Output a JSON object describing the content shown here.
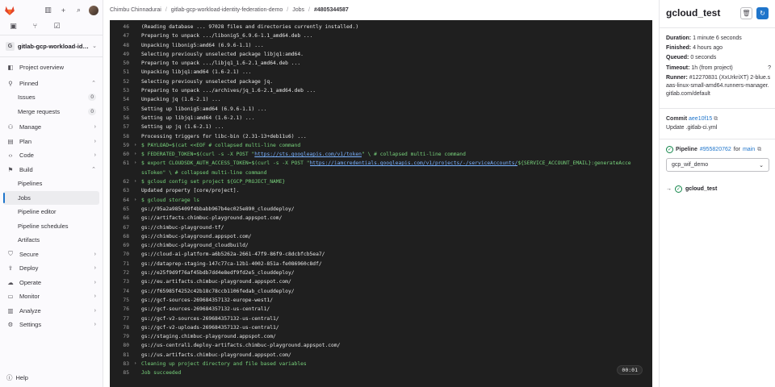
{
  "sidebar": {
    "project_initial": "G",
    "project_name": "gitlab-gcp-workload-ide...",
    "items": [
      {
        "label": "Project overview",
        "icon": "project-icon"
      },
      {
        "label": "Pinned",
        "icon": "pin-icon"
      },
      {
        "label": "Issues",
        "count": "0"
      },
      {
        "label": "Merge requests",
        "count": "0"
      },
      {
        "label": "Manage",
        "icon": "users-icon"
      },
      {
        "label": "Plan",
        "icon": "plan-icon"
      },
      {
        "label": "Code",
        "icon": "code-icon"
      },
      {
        "label": "Build",
        "icon": "rocket-icon"
      },
      {
        "label": "Pipelines"
      },
      {
        "label": "Jobs"
      },
      {
        "label": "Pipeline editor"
      },
      {
        "label": "Pipeline schedules"
      },
      {
        "label": "Artifacts"
      },
      {
        "label": "Secure",
        "icon": "shield-icon"
      },
      {
        "label": "Deploy",
        "icon": "deploy-icon"
      },
      {
        "label": "Operate",
        "icon": "cloud-icon"
      },
      {
        "label": "Monitor",
        "icon": "monitor-icon"
      },
      {
        "label": "Analyze",
        "icon": "chart-icon"
      },
      {
        "label": "Settings",
        "icon": "gear-icon"
      }
    ],
    "help": "Help"
  },
  "breadcrumb": [
    "Chimbu Chinnadurai",
    "gitlab-gcp-workload-identity-federation-demo",
    "Jobs",
    "#4805344587"
  ],
  "log": {
    "lines": [
      {
        "n": "46",
        "t": "(Reading database ... 97028 files and directories currently installed.)"
      },
      {
        "n": "47",
        "t": "Preparing to unpack .../libonig5_6.9.6-1.1_amd64.deb ..."
      },
      {
        "n": "48",
        "t": "Unpacking libonig5:amd64 (6.9.6-1.1) ..."
      },
      {
        "n": "49",
        "t": "Selecting previously unselected package libjq1:amd64."
      },
      {
        "n": "50",
        "t": "Preparing to unpack .../libjq1_1.6-2.1_amd64.deb ..."
      },
      {
        "n": "51",
        "t": "Unpacking libjq1:amd64 (1.6-2.1) ..."
      },
      {
        "n": "52",
        "t": "Selecting previously unselected package jq."
      },
      {
        "n": "53",
        "t": "Preparing to unpack .../archives/jq_1.6-2.1_amd64.deb ..."
      },
      {
        "n": "54",
        "t": "Unpacking jq (1.6-2.1) ..."
      },
      {
        "n": "55",
        "t": "Setting up libonig5:amd64 (6.9.6-1.1) ..."
      },
      {
        "n": "56",
        "t": "Setting up libjq1:amd64 (1.6-2.1) ..."
      },
      {
        "n": "57",
        "t": "Setting up jq (1.6-2.1) ..."
      },
      {
        "n": "58",
        "t": "Processing triggers for libc-bin (2.31-13+deb11u6) ..."
      },
      {
        "n": "59",
        "t": "$ PAYLOAD=$(cat <<EOF # collapsed multi-line command"
      },
      {
        "n": "60",
        "t": "$ FEDERATED_TOKEN=$(curl -s -X POST \"",
        "u": "https://sts.googleapis.com/v1/token",
        "t2": "\" \\ # collapsed multi-line command"
      },
      {
        "n": "61",
        "t": "$ export CLOUDSDK_AUTH_ACCESS_TOKEN=$(curl -s -X POST \"",
        "u": "https://iamcredentials.googleapis.com/v1/projects/-/serviceAccounts/",
        "t2": "${SERVICE_ACCOUNT_EMAIL}:generateAcce"
      },
      {
        "n": "",
        "t": "ssToken\" \\ # collapsed multi-line command"
      },
      {
        "n": "62",
        "t": "$ gcloud config set project ${GCP_PROJECT_NAME}"
      },
      {
        "n": "63",
        "t": "Updated property [core/project]."
      },
      {
        "n": "64",
        "t": "$ gcloud storage ls"
      },
      {
        "n": "65",
        "t": "gs://95a2a985409f4bbabb967b4ec025e890_clouddeploy/"
      },
      {
        "n": "66",
        "t": "gs://artifacts.chimbuc-playground.appspot.com/"
      },
      {
        "n": "67",
        "t": "gs://chimbuc-playground-tf/"
      },
      {
        "n": "68",
        "t": "gs://chimbuc-playground.appspot.com/"
      },
      {
        "n": "69",
        "t": "gs://chimbuc-playground_cloudbuild/"
      },
      {
        "n": "70",
        "t": "gs://cloud-ai-platform-a6b5262a-2661-47f9-86f9-c8dcbfcb5ea7/"
      },
      {
        "n": "71",
        "t": "gs://dataprep-staging-147c77ca-12b1-4002-851a-fe086960c8df/"
      },
      {
        "n": "72",
        "t": "gs://e25f9d9f76af45bdb7dd4e8edf9fd2e5_clouddeploy/"
      },
      {
        "n": "73",
        "t": "gs://eu.artifacts.chimbuc-playground.appspot.com/"
      },
      {
        "n": "74",
        "t": "gs://f65985f4252c42b18c78ccb1106fedab_clouddeploy/"
      },
      {
        "n": "75",
        "t": "gs://gcf-sources-269684357132-europe-west1/"
      },
      {
        "n": "76",
        "t": "gs://gcf-sources-269684357132-us-central1/"
      },
      {
        "n": "77",
        "t": "gs://gcf-v2-sources-269684357132-us-central1/"
      },
      {
        "n": "78",
        "t": "gs://gcf-v2-uploads-269684357132-us-central1/"
      },
      {
        "n": "79",
        "t": "gs://staging.chimbuc-playground.appspot.com/"
      },
      {
        "n": "80",
        "t": "gs://us-central1.deploy-artifacts.chimbuc-playground.appspot.com/"
      },
      {
        "n": "81",
        "t": "gs://us.artifacts.chimbuc-playground.appspot.com/"
      },
      {
        "n": "83",
        "t": "Cleaning up project directory and file based variables"
      },
      {
        "n": "85",
        "t": "Job succeeded"
      }
    ],
    "timer": "00:01"
  },
  "panel": {
    "title": "gcloud_test",
    "duration_label": "Duration:",
    "duration": "1 minute 6 seconds",
    "finished_label": "Finished:",
    "finished": "4 hours ago",
    "queued_label": "Queued:",
    "queued": "0 seconds",
    "timeout_label": "Timeout:",
    "timeout": "1h (from project)",
    "runner_label": "Runner:",
    "runner": "#12270831 (XxUrkriXT) 2-blue.saas-linux-small-amd64.runners-manager.gitlab.com/default",
    "commit_label": "Commit",
    "commit_sha": "aee10f15",
    "commit_msg": "Update .gitlab-ci.yml",
    "pipeline_label": "Pipeline",
    "pipeline_id": "#955820762",
    "pipeline_for": "for",
    "pipeline_ref": "main",
    "stage": "gcp_wif_demo",
    "job_name": "gcloud_test"
  },
  "colors": {
    "accent": "#1f75cb",
    "success": "#108548",
    "log_bg": "#1f1f1f",
    "log_green": "#78d37c"
  }
}
